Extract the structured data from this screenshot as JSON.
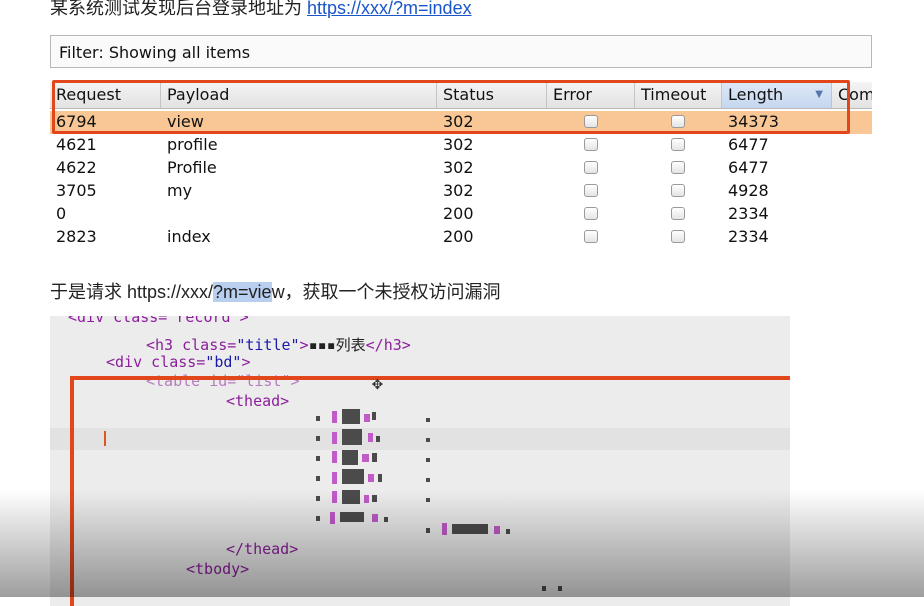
{
  "intro": {
    "text": "某系统测试发现后台登录地址为 ",
    "link": "https://xxx/?m=index"
  },
  "burp": {
    "filter": "Filter: Showing all items",
    "columns": [
      "Request",
      "Payload",
      "Status",
      "Error",
      "Timeout",
      "Length",
      "Com"
    ],
    "rows": [
      {
        "request": "6794",
        "payload": "view",
        "status": "302",
        "length": "34373"
      },
      {
        "request": "4621",
        "payload": "profile",
        "status": "302",
        "length": "6477"
      },
      {
        "request": "4622",
        "payload": "Profile",
        "status": "302",
        "length": "6477"
      },
      {
        "request": "3705",
        "payload": "my",
        "status": "302",
        "length": "4928"
      },
      {
        "request": "0",
        "payload": "",
        "status": "200",
        "length": "2334"
      },
      {
        "request": "2823",
        "payload": "index",
        "status": "200",
        "length": "2334"
      }
    ]
  },
  "line2": {
    "prefix": "于是请求 https://xxx/",
    "highlight": "?m=vie",
    "suffix": "w，获取一个未授权访问漏洞"
  },
  "code": {
    "line1": "<div class=\"record\">",
    "h3_open": "<h3 class=",
    "h3_val": "\"title\"",
    "h3_text": "▪▪▪列表",
    "h3_close": "</h3>",
    "div_bd_open": "<div class=",
    "div_bd_val": "\"bd\"",
    "div_bd_close": ">",
    "table": "<table id=\"list\">",
    "thead_open": "<thead>",
    "thead_close": "</thead>",
    "tbody_open": "<tbody>"
  }
}
